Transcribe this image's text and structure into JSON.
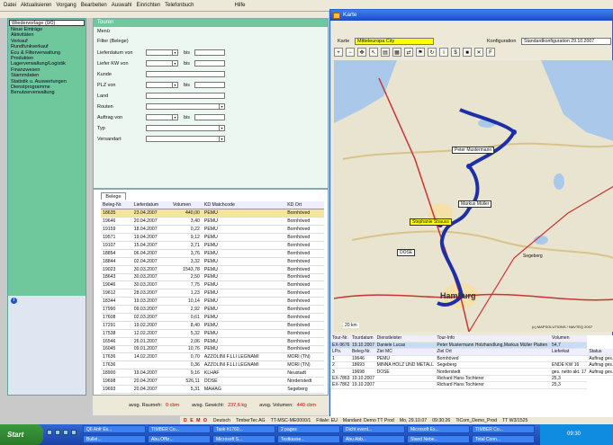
{
  "menu": [
    "Datei",
    "Aktualisieren",
    "Vorgang",
    "Bearbeiten",
    "Auswahl",
    "Einrichten",
    "Telefonbuch",
    "Hilfe"
  ],
  "left_nav": {
    "selected": "Wiedervorlage (0/0)",
    "items": [
      "Neue Einträge",
      "Aktivitäten",
      "Verkauf",
      "Rundfunkverkauf",
      "Ecu & Filterverwaltung",
      "Produkten",
      "Lagerverwaltung/Logistik",
      "Finanzwesen",
      "Stammdaten",
      "Statistik u. Auswertungen",
      "Dienstprogramme",
      "Benutzerverwaltung"
    ]
  },
  "search": {
    "title": "Touren",
    "menu_label": "Menü",
    "filter_label": "Filter (Belege)",
    "fields": [
      "Lieferdatum von",
      "Liefer KW von",
      "Kunde",
      "PLZ von",
      "Land",
      "Routen",
      "Auftrag von",
      "Typ",
      "Versandart"
    ],
    "bis": "bis"
  },
  "grid": {
    "tab": "Belege",
    "columns": [
      "Beleg-Nr.",
      "Lieferdatum",
      "Volumen",
      "KD Matchcode",
      "KD Ort"
    ],
    "rows": [
      [
        "18635",
        "23.04.2007",
        "440,00",
        "PEMU",
        "Bornhöved"
      ],
      [
        "19646",
        "20.04.2007",
        "3,40",
        "PEMU",
        "Bornhöved"
      ],
      [
        "19159",
        "18.04.2007",
        "0,22",
        "PEMU",
        "Bornhöved"
      ],
      [
        "19571",
        "19.04.2007",
        "9,12",
        "PEMU",
        "Bornhöved"
      ],
      [
        "19107",
        "15.04.2007",
        "3,71",
        "PEMU",
        "Bornhöved"
      ],
      [
        "18854",
        "06.04.2007",
        "3,76",
        "PEMU",
        "Bornhöved"
      ],
      [
        "18844",
        "02.04.2007",
        "3,32",
        "PEMU",
        "Bornhöved"
      ],
      [
        "19023",
        "30.03.2007",
        "1543,78",
        "PEMU",
        "Bornhöved"
      ],
      [
        "18643",
        "30.03.2007",
        "2,50",
        "PEMU",
        "Bornhöved"
      ],
      [
        "19046",
        "30.03.2007",
        "7,75",
        "PEMU",
        "Bornhöved"
      ],
      [
        "19612",
        "28.03.2007",
        "1,23",
        "PEMU",
        "Bornhöved"
      ],
      [
        "18344",
        "19.03.2007",
        "10,14",
        "PEMU",
        "Bornhöved"
      ],
      [
        "17990",
        "09.03.2007",
        "2,92",
        "PEMU",
        "Bornhöved"
      ],
      [
        "17608",
        "02.03.2007",
        "0,61",
        "PEMU",
        "Bornhöved"
      ],
      [
        "17291",
        "19.02.2007",
        "8,40",
        "PEMU",
        "Bornhöved"
      ],
      [
        "17538",
        "12.02.2007",
        "5,32",
        "PEMU",
        "Bornhöved"
      ],
      [
        "16546",
        "26.01.2007",
        "2,06",
        "PEMU",
        "Bornhöved"
      ],
      [
        "16045",
        "09.01.2007",
        "10,76",
        "PEMU",
        "Bornhöved"
      ],
      [
        "17636",
        "14.02.2007",
        "0,70",
        "AZZOLINI F.LLI LEGNAMI",
        "MORI (TN)"
      ],
      [
        "17636",
        "",
        "0,36",
        "AZZOLINI F.LLI LEGNAMI",
        "MORI (TN)"
      ],
      [
        "18900",
        "19.04.2007",
        "9,16",
        "KLHAF",
        "Neustadt"
      ],
      [
        "19698",
        "20.04.2007",
        "526,11",
        "DOSE",
        "Norderstedt"
      ],
      [
        "19693",
        "20.04.2007",
        "5,31",
        "MAHAG",
        "Segeberg"
      ]
    ]
  },
  "status": {
    "raumeh_label": "avsg. Raumeh:",
    "raumeh": "0 cbm",
    "gewicht_label": "avsg. Gewicht:",
    "gewicht": "237,6 kg",
    "volumen_label": "avsg. Volumen:",
    "volumen": "440 cbm"
  },
  "demo_bar": [
    "D E M O",
    "Deutsch",
    "TimberTec AG",
    "TT-MSC-ME0000/1",
    "Filiale: EU",
    "Mandant: Demo TT Prod",
    "Mo, 29.10.07",
    "09:30:26",
    "TiCom_Demo_Prod",
    "TT W3/1525"
  ],
  "karte": {
    "title": "Karte",
    "map_label": "Karte",
    "map_value": "Mitteleuropa City",
    "config_label": "Konfiguration",
    "config_value": "Standardkonfiguration 29.10.2007"
  },
  "map": {
    "places": [
      "Peter Mustermann",
      "Markus Müller",
      "Stephanie Strauss",
      "Hamburg",
      "DOSE",
      "Segeberg"
    ],
    "scale": "20 km",
    "copyright": "(c) MAPSOLUTIONS / NAVTEQ 2007"
  },
  "tour": {
    "columns": [
      "Tour-Nr.",
      "Tourdatum",
      "Dienstleister",
      "Tour-Info",
      "Volumen"
    ],
    "main_rows": [
      [
        "EX-9676",
        "19.10.2007",
        "Daniele Lucas",
        "Peter Mustermann Holzhandlung,Markus Müller Platten",
        "54,7"
      ],
      [
        "EX-7863",
        "19.10.2007",
        "",
        "Richard Hans Tochterer",
        "25,3"
      ],
      [
        "EX-7862",
        "19.10.2007",
        "",
        "Richard Hans Tochterer",
        "25,3"
      ]
    ],
    "sub_columns": [
      "LPo.",
      "Beleg-Nr.",
      "Ziel MC",
      "Ziel Ort",
      "Lieferkat",
      "Status"
    ],
    "sub_rows": [
      [
        "1",
        "19646",
        "PEMU",
        "Bornhöved",
        "",
        "Auftrag ges."
      ],
      [
        "2",
        "18693",
        "MINNA HOLZ UND METALL",
        "Segeberg",
        "ENDE KW 16",
        "Auftrag ges."
      ],
      [
        "3",
        "19698",
        "DOSE",
        "Norderstedt",
        "ges. netto akt. 17",
        "Auftrag ges."
      ]
    ]
  },
  "taskbar": {
    "start": "Start",
    "buttons": [
      "Q6 Abfr Ex...",
      "TIMBER Co...",
      "Task #1760...",
      "2 pages",
      "Dicht event...",
      "Microsoft Ex...",
      "TIMBER Co...",
      "Bullet...",
      "Abu.Offiz...",
      "Microsoft S...",
      "Testkasse...",
      "Abu Abb...",
      "Stand Nebe...",
      "Total Conn..."
    ],
    "clock": "09:30"
  }
}
